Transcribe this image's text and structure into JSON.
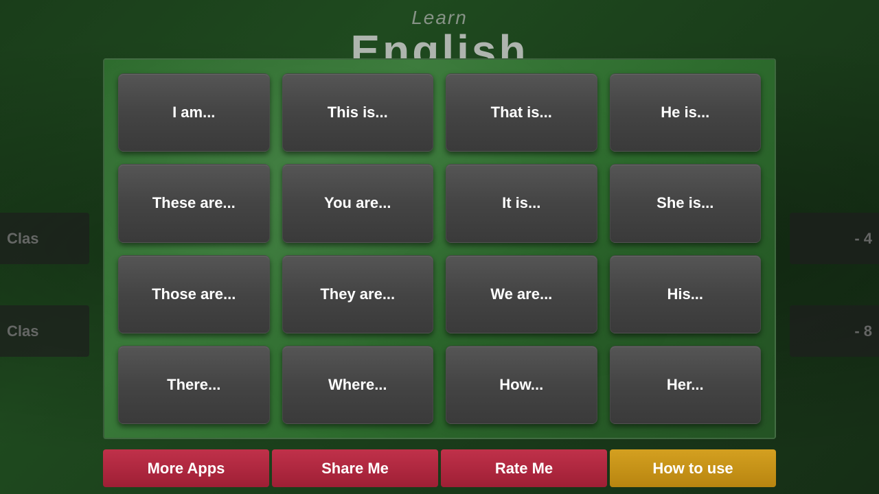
{
  "header": {
    "learn_label": "Learn",
    "title": "English"
  },
  "side_panels": {
    "left_top_text": "Clas",
    "left_bottom_text": "Clas",
    "right_top_number": "- 4",
    "right_bottom_number": "- 8"
  },
  "grid": {
    "buttons": [
      "I am...",
      "This is...",
      "That is...",
      "He is...",
      "These are...",
      "You are...",
      "It is...",
      "She is...",
      "Those are...",
      "They are...",
      "We are...",
      "His...",
      "There...",
      "Where...",
      "How...",
      "Her..."
    ]
  },
  "bottom_bar": {
    "more_apps": "More Apps",
    "share_me": "Share Me",
    "rate_me": "Rate Me",
    "how_to_use": "How to use"
  }
}
